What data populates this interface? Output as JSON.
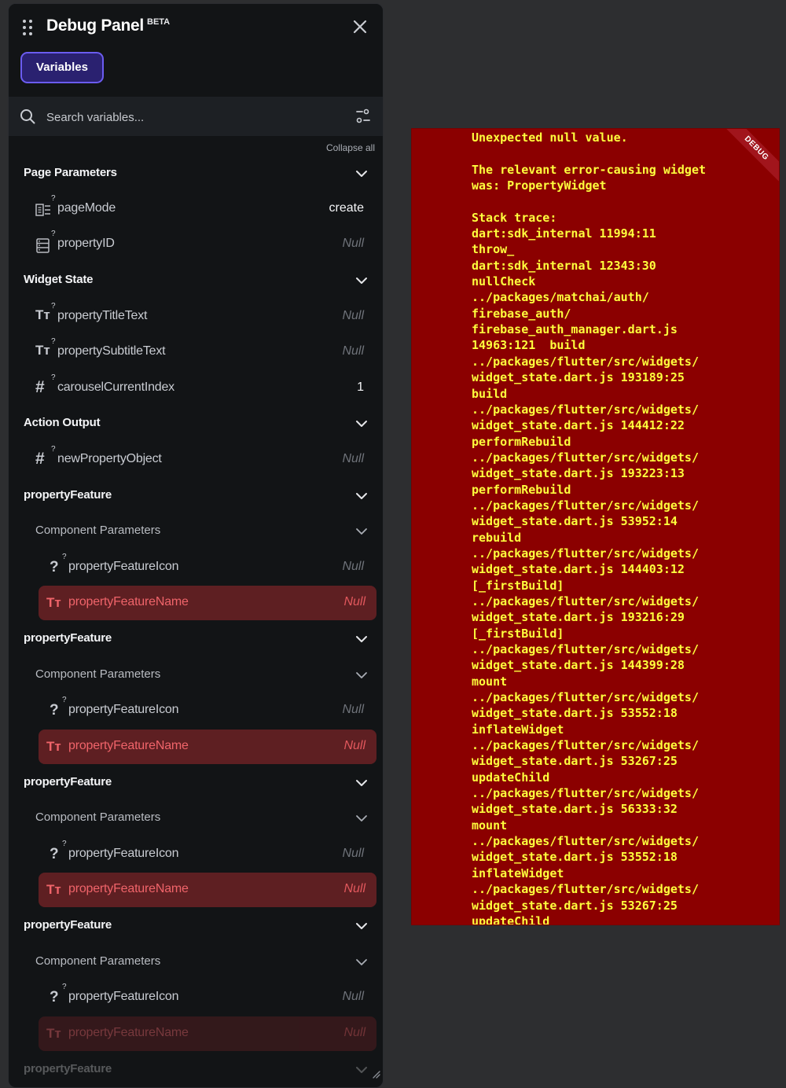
{
  "panel": {
    "title": "Debug Panel",
    "badge": "BETA",
    "tab_variables": "Variables",
    "search_placeholder": "Search variables...",
    "collapse_all": "Collapse all"
  },
  "sections": {
    "page_parameters": "Page Parameters",
    "widget_state": "Widget State",
    "action_output": "Action Output",
    "property_feature": "propertyFeature",
    "component_parameters": "Component Parameters"
  },
  "vars": {
    "page_mode": {
      "name": "pageMode",
      "value": "create"
    },
    "property_id": {
      "name": "propertyID",
      "value": "Null"
    },
    "property_title_text": {
      "name": "propertyTitleText",
      "value": "Null"
    },
    "property_subtitle_text": {
      "name": "propertySubtitleText",
      "value": "Null"
    },
    "carousel_current_index": {
      "name": "carouselCurrentIndex",
      "value": "1"
    },
    "new_property_object": {
      "name": "newPropertyObject",
      "value": "Null"
    },
    "property_feature_icon": {
      "name": "propertyFeatureIcon",
      "value": "Null"
    },
    "property_feature_name": {
      "name": "propertyFeatureName",
      "value": "Null"
    }
  },
  "icons": {
    "question": "?",
    "text_type": "Tт",
    "number": "#",
    "superscript": "?"
  },
  "error": {
    "ribbon": "DEBUG",
    "text": "Unexpected null value.\n\nThe relevant error-causing widget\nwas: PropertyWidget\n\nStack trace:\ndart:sdk_internal 11994:11\nthrow_\ndart:sdk_internal 12343:30\nnullCheck\n../packages/matchai/auth/\nfirebase_auth/\nfirebase_auth_manager.dart.js\n14963:121  build\n../packages/flutter/src/widgets/\nwidget_state.dart.js 193189:25\nbuild\n../packages/flutter/src/widgets/\nwidget_state.dart.js 144412:22\nperformRebuild\n../packages/flutter/src/widgets/\nwidget_state.dart.js 193223:13\nperformRebuild\n../packages/flutter/src/widgets/\nwidget_state.dart.js 53952:14\nrebuild\n../packages/flutter/src/widgets/\nwidget_state.dart.js 144403:12\n[_firstBuild]\n../packages/flutter/src/widgets/\nwidget_state.dart.js 193216:29\n[_firstBuild]\n../packages/flutter/src/widgets/\nwidget_state.dart.js 144399:28\nmount\n../packages/flutter/src/widgets/\nwidget_state.dart.js 53552:18\ninflateWidget\n../packages/flutter/src/widgets/\nwidget_state.dart.js 53267:25\nupdateChild\n../packages/flutter/src/widgets/\nwidget_state.dart.js 56333:32\nmount\n../packages/flutter/src/widgets/\nwidget_state.dart.js 53552:18\ninflateWidget\n../packages/flutter/src/widgets/\nwidget_state.dart.js 53267:25\nupdateChild"
  }
}
